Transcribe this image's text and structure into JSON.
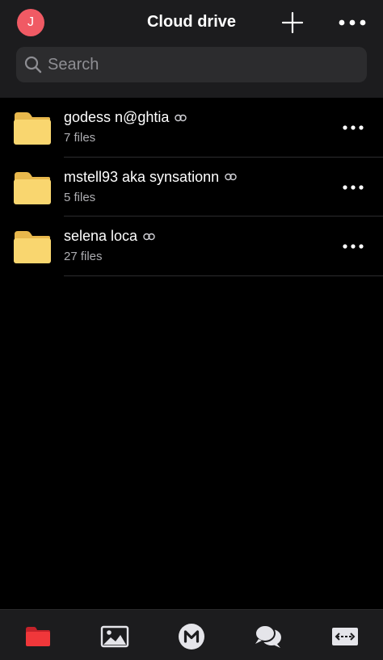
{
  "header": {
    "avatar_initial": "J",
    "title": "Cloud drive"
  },
  "search": {
    "placeholder": "Search"
  },
  "folders": [
    {
      "name": "godess n@ghtia",
      "count": "7 files"
    },
    {
      "name": "mstell93 aka synsationn",
      "count": "5 files"
    },
    {
      "name": "selena loca",
      "count": "27 files"
    }
  ],
  "tabbar": {
    "items": [
      {
        "icon": "folder-icon",
        "active": true
      },
      {
        "icon": "photos-icon",
        "active": false
      },
      {
        "icon": "mega-logo-icon",
        "active": false
      },
      {
        "icon": "chat-icon",
        "active": false
      },
      {
        "icon": "transfers-icon",
        "active": false
      }
    ]
  },
  "colors": {
    "accent": "#f0373a",
    "avatar": "#f05a64",
    "folder": "#f9d66f",
    "background": "#000000",
    "bar": "#1c1c1e"
  }
}
